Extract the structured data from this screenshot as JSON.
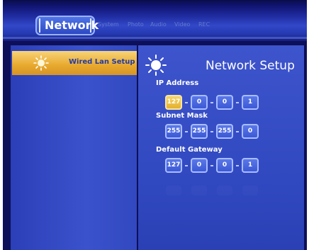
{
  "top_bar": {
    "active_tab": "Network",
    "tabs": [
      "System",
      "Photo",
      "Audio",
      "Video",
      "REC"
    ]
  },
  "sidebar": {
    "items": [
      {
        "label": "Wired Lan Setup",
        "icon": "sun-icon",
        "selected": true
      }
    ]
  },
  "panel": {
    "title": "Network Setup",
    "icon": "sun-icon",
    "fields": [
      {
        "label": "IP Address",
        "octets": [
          "127",
          "0",
          "0",
          "1"
        ],
        "selected_octet": 0
      },
      {
        "label": "Subnet Mask",
        "octets": [
          "255",
          "255",
          "255",
          "0"
        ]
      },
      {
        "label": "Default Gateway",
        "octets": [
          "127",
          "0",
          "0",
          "1"
        ]
      }
    ]
  },
  "colors": {
    "background": "#0d0f58",
    "highlight": "#e8a92e",
    "panel": "#3d54cc",
    "octet_fill": "#4a68e0"
  }
}
